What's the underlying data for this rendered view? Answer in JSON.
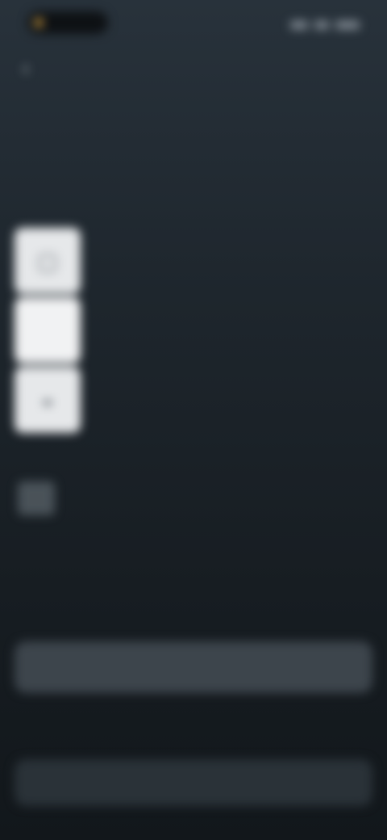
{
  "status_bar": {
    "time": "",
    "icons": [
      "signal-icon",
      "wifi-icon",
      "battery-icon"
    ]
  },
  "nav": {
    "back_icon": "chevron-left-icon",
    "title": ""
  },
  "content": {
    "heading": "",
    "subheading": "",
    "description": "",
    "rows": [
      {
        "icon": "card-icon",
        "label": "",
        "value": ""
      },
      {
        "icon": "blank-icon",
        "label": "",
        "value": ""
      },
      {
        "icon": "wallet-icon",
        "label": "",
        "value": ""
      }
    ],
    "secondary": {
      "icon": "document-icon",
      "value": ""
    },
    "note": ""
  },
  "footer": {
    "primary_button": "",
    "terms_text": "",
    "terms_link": "",
    "secondary_button": ""
  },
  "colors": {
    "background_top": "#28323b",
    "background_bottom": "#12171b",
    "tile": "#e6e8ea",
    "button": "#3d454c"
  }
}
